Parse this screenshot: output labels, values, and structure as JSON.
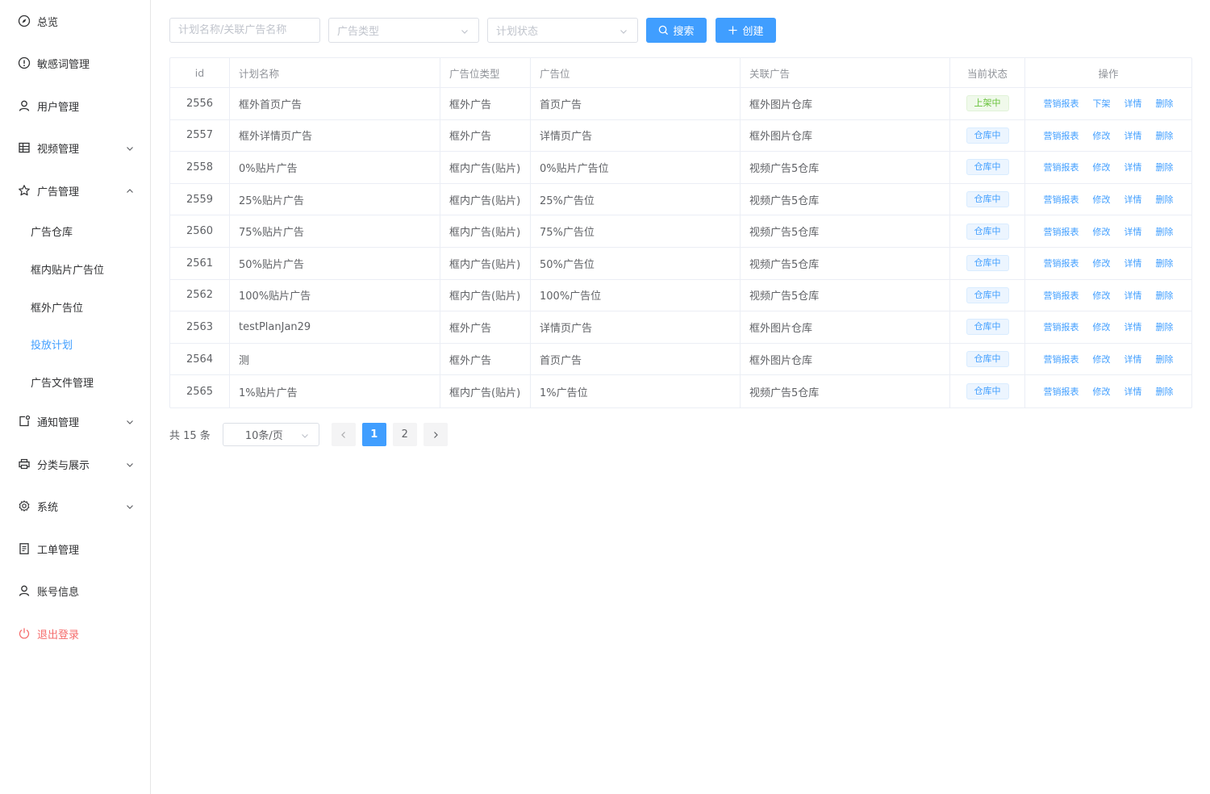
{
  "sidebar": {
    "items": [
      {
        "label": "总览",
        "icon": "compass-icon"
      },
      {
        "label": "敏感词管理",
        "icon": "warning-icon"
      },
      {
        "label": "用户管理",
        "icon": "user-icon"
      },
      {
        "label": "视频管理",
        "icon": "grid-icon"
      },
      {
        "label": "广告管理",
        "icon": "star-icon"
      },
      {
        "label": "广告仓库"
      },
      {
        "label": "框内贴片广告位"
      },
      {
        "label": "框外广告位"
      },
      {
        "label": "投放计划"
      },
      {
        "label": "广告文件管理"
      },
      {
        "label": "通知管理",
        "icon": "notification-icon"
      },
      {
        "label": "分类与展示",
        "icon": "printer-icon"
      },
      {
        "label": "系统",
        "icon": "gear-icon"
      },
      {
        "label": "工单管理",
        "icon": "document-icon"
      },
      {
        "label": "账号信息",
        "icon": "user-icon"
      },
      {
        "label": "退出登录",
        "icon": "power-icon"
      }
    ]
  },
  "toolbar": {
    "search_placeholder": "计划名称/关联广告名称",
    "ad_type_placeholder": "广告类型",
    "plan_status_placeholder": "计划状态",
    "search_label": "搜索",
    "create_label": "创建"
  },
  "table": {
    "headers": {
      "id": "id",
      "name": "计划名称",
      "type": "广告位类型",
      "pos": "广告位",
      "ad": "关联广告",
      "status": "当前状态",
      "ops": "操作"
    },
    "rows": [
      {
        "id": "2556",
        "name": "框外首页广告",
        "type": "框外广告",
        "pos": "首页广告",
        "ad": "框外图片仓库",
        "status": "上架中",
        "op1": "营销报表",
        "op2": "下架",
        "op3": "详情",
        "op4": "删除"
      },
      {
        "id": "2557",
        "name": "框外详情页广告",
        "type": "框外广告",
        "pos": "详情页广告",
        "ad": "框外图片仓库",
        "status": "仓库中",
        "op1": "营销报表",
        "op2": "修改",
        "op3": "详情",
        "op4": "删除"
      },
      {
        "id": "2558",
        "name": "0%贴片广告",
        "type": "框内广告(贴片)",
        "pos": "0%贴片广告位",
        "ad": "视频广告5仓库",
        "status": "仓库中",
        "op1": "营销报表",
        "op2": "修改",
        "op3": "详情",
        "op4": "删除"
      },
      {
        "id": "2559",
        "name": "25%贴片广告",
        "type": "框内广告(贴片)",
        "pos": "25%广告位",
        "ad": "视频广告5仓库",
        "status": "仓库中",
        "op1": "营销报表",
        "op2": "修改",
        "op3": "详情",
        "op4": "删除"
      },
      {
        "id": "2560",
        "name": "75%贴片广告",
        "type": "框内广告(贴片)",
        "pos": "75%广告位",
        "ad": "视频广告5仓库",
        "status": "仓库中",
        "op1": "营销报表",
        "op2": "修改",
        "op3": "详情",
        "op4": "删除"
      },
      {
        "id": "2561",
        "name": "50%贴片广告",
        "type": "框内广告(贴片)",
        "pos": "50%广告位",
        "ad": "视频广告5仓库",
        "status": "仓库中",
        "op1": "营销报表",
        "op2": "修改",
        "op3": "详情",
        "op4": "删除"
      },
      {
        "id": "2562",
        "name": "100%贴片广告",
        "type": "框内广告(贴片)",
        "pos": "100%广告位",
        "ad": "视频广告5仓库",
        "status": "仓库中",
        "op1": "营销报表",
        "op2": "修改",
        "op3": "详情",
        "op4": "删除"
      },
      {
        "id": "2563",
        "name": "testPlanJan29",
        "type": "框外广告",
        "pos": "详情页广告",
        "ad": "框外图片仓库",
        "status": "仓库中",
        "op1": "营销报表",
        "op2": "修改",
        "op3": "详情",
        "op4": "删除"
      },
      {
        "id": "2564",
        "name": "测",
        "type": "框外广告",
        "pos": "首页广告",
        "ad": "框外图片仓库",
        "status": "仓库中",
        "op1": "营销报表",
        "op2": "修改",
        "op3": "详情",
        "op4": "删除"
      },
      {
        "id": "2565",
        "name": "1%贴片广告",
        "type": "框内广告(贴片)",
        "pos": "1%广告位",
        "ad": "视频广告5仓库",
        "status": "仓库中",
        "op1": "营销报表",
        "op2": "修改",
        "op3": "详情",
        "op4": "删除"
      }
    ]
  },
  "pagination": {
    "total": "共 15 条",
    "page_size": "10条/页",
    "page1": "1",
    "page2": "2"
  },
  "colors": {
    "primary": "#409eff",
    "success": "#67c23a",
    "danger": "#f56c6c"
  }
}
